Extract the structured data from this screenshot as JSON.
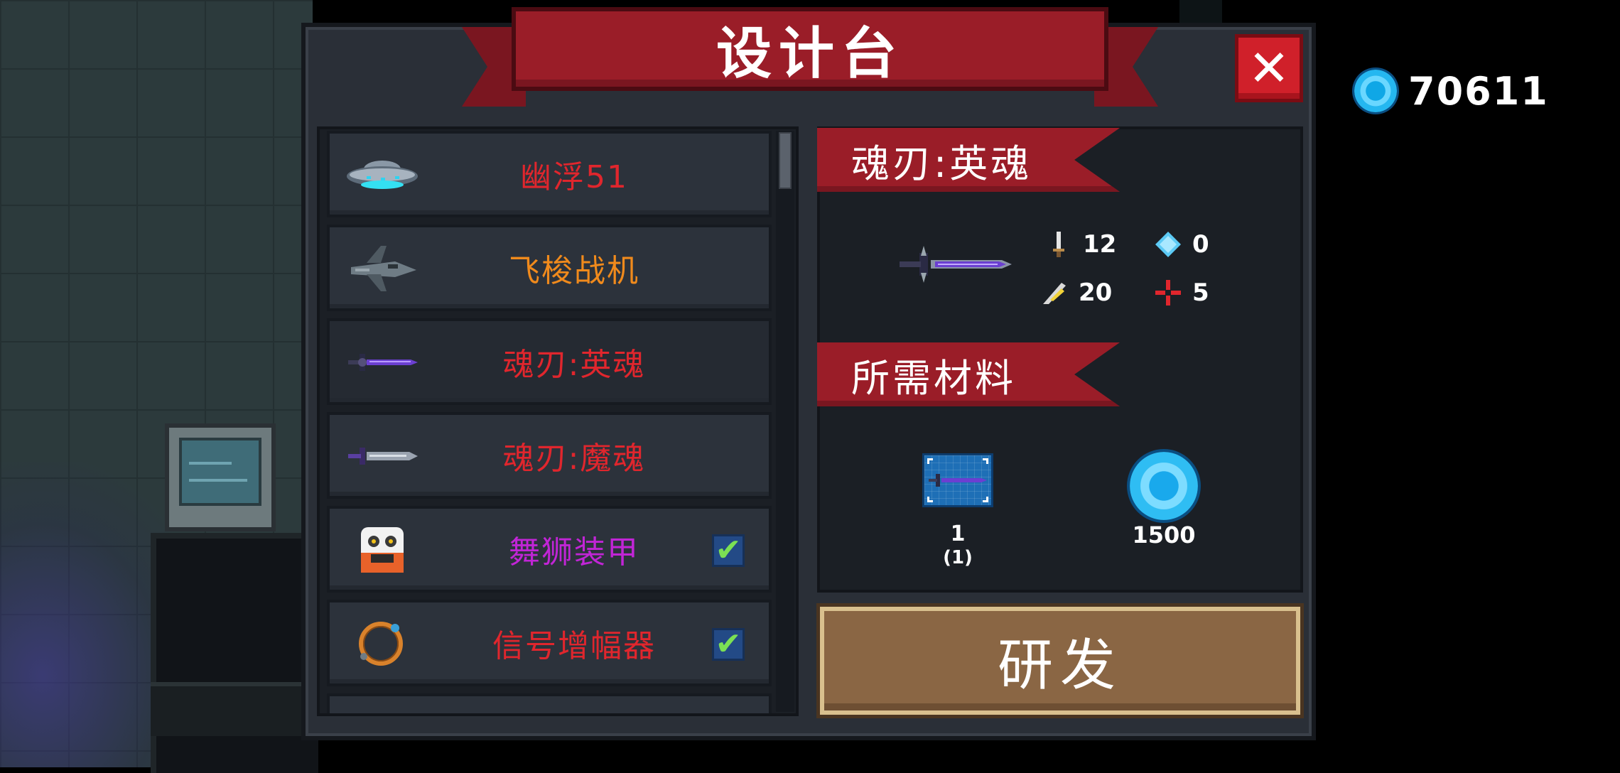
{
  "currency": {
    "icon": "gem-icon",
    "value": "70611"
  },
  "panel": {
    "title": "设计台",
    "close_label": "✕"
  },
  "items": [
    {
      "name": "幽浮51",
      "icon": "ufo-icon",
      "color": "#e0262d",
      "checked": false,
      "selected": false
    },
    {
      "name": "飞梭战机",
      "icon": "fighter-jet-icon",
      "color": "#f08a1c",
      "checked": false,
      "selected": false
    },
    {
      "name": "魂刃:英魂",
      "icon": "sword-icon",
      "color": "#e0262d",
      "checked": false,
      "selected": true
    },
    {
      "name": "魂刃:魔魂",
      "icon": "dagger-icon",
      "color": "#e0262d",
      "checked": false,
      "selected": false
    },
    {
      "name": "舞狮装甲",
      "icon": "lion-dance-icon",
      "color": "#c125d6",
      "checked": true,
      "selected": false
    },
    {
      "name": "信号增幅器",
      "icon": "ring-icon",
      "color": "#e0262d",
      "checked": true,
      "selected": false
    }
  ],
  "check_mark": "✔",
  "detail": {
    "name": "魂刃:英魂",
    "stats": {
      "damage": "12",
      "energy": "0",
      "speed": "20",
      "crit": "5"
    }
  },
  "materials": {
    "label": "所需材料",
    "blueprint": {
      "icon": "blueprint-icon",
      "qty": "1",
      "owned": "(1)"
    },
    "gems": {
      "icon": "gem-icon",
      "qty": "1500"
    }
  },
  "develop_label": "研发",
  "colors": {
    "ribbon": "#9a1d28",
    "panel": "#2a2f37",
    "button": "#8a6644",
    "gem": "#25b7f0"
  }
}
